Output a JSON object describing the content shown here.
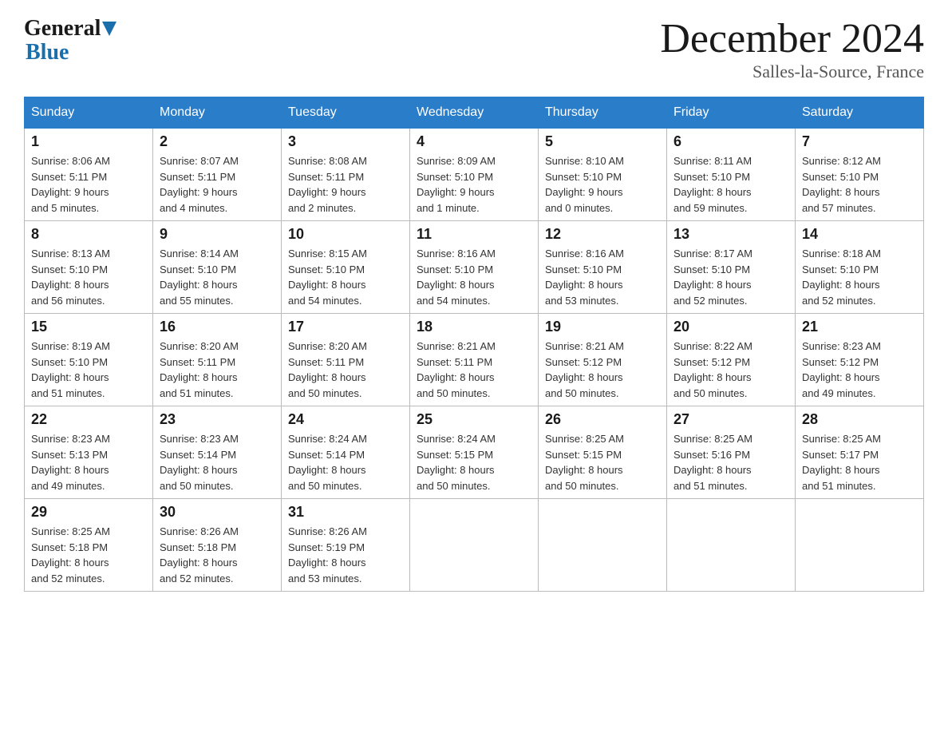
{
  "logo": {
    "general": "General",
    "blue": "Blue",
    "arrow": "▶"
  },
  "title": "December 2024",
  "location": "Salles-la-Source, France",
  "days_of_week": [
    "Sunday",
    "Monday",
    "Tuesday",
    "Wednesday",
    "Thursday",
    "Friday",
    "Saturday"
  ],
  "weeks": [
    [
      {
        "day": "1",
        "info": "Sunrise: 8:06 AM\nSunset: 5:11 PM\nDaylight: 9 hours\nand 5 minutes."
      },
      {
        "day": "2",
        "info": "Sunrise: 8:07 AM\nSunset: 5:11 PM\nDaylight: 9 hours\nand 4 minutes."
      },
      {
        "day": "3",
        "info": "Sunrise: 8:08 AM\nSunset: 5:11 PM\nDaylight: 9 hours\nand 2 minutes."
      },
      {
        "day": "4",
        "info": "Sunrise: 8:09 AM\nSunset: 5:10 PM\nDaylight: 9 hours\nand 1 minute."
      },
      {
        "day": "5",
        "info": "Sunrise: 8:10 AM\nSunset: 5:10 PM\nDaylight: 9 hours\nand 0 minutes."
      },
      {
        "day": "6",
        "info": "Sunrise: 8:11 AM\nSunset: 5:10 PM\nDaylight: 8 hours\nand 59 minutes."
      },
      {
        "day": "7",
        "info": "Sunrise: 8:12 AM\nSunset: 5:10 PM\nDaylight: 8 hours\nand 57 minutes."
      }
    ],
    [
      {
        "day": "8",
        "info": "Sunrise: 8:13 AM\nSunset: 5:10 PM\nDaylight: 8 hours\nand 56 minutes."
      },
      {
        "day": "9",
        "info": "Sunrise: 8:14 AM\nSunset: 5:10 PM\nDaylight: 8 hours\nand 55 minutes."
      },
      {
        "day": "10",
        "info": "Sunrise: 8:15 AM\nSunset: 5:10 PM\nDaylight: 8 hours\nand 54 minutes."
      },
      {
        "day": "11",
        "info": "Sunrise: 8:16 AM\nSunset: 5:10 PM\nDaylight: 8 hours\nand 54 minutes."
      },
      {
        "day": "12",
        "info": "Sunrise: 8:16 AM\nSunset: 5:10 PM\nDaylight: 8 hours\nand 53 minutes."
      },
      {
        "day": "13",
        "info": "Sunrise: 8:17 AM\nSunset: 5:10 PM\nDaylight: 8 hours\nand 52 minutes."
      },
      {
        "day": "14",
        "info": "Sunrise: 8:18 AM\nSunset: 5:10 PM\nDaylight: 8 hours\nand 52 minutes."
      }
    ],
    [
      {
        "day": "15",
        "info": "Sunrise: 8:19 AM\nSunset: 5:10 PM\nDaylight: 8 hours\nand 51 minutes."
      },
      {
        "day": "16",
        "info": "Sunrise: 8:20 AM\nSunset: 5:11 PM\nDaylight: 8 hours\nand 51 minutes."
      },
      {
        "day": "17",
        "info": "Sunrise: 8:20 AM\nSunset: 5:11 PM\nDaylight: 8 hours\nand 50 minutes."
      },
      {
        "day": "18",
        "info": "Sunrise: 8:21 AM\nSunset: 5:11 PM\nDaylight: 8 hours\nand 50 minutes."
      },
      {
        "day": "19",
        "info": "Sunrise: 8:21 AM\nSunset: 5:12 PM\nDaylight: 8 hours\nand 50 minutes."
      },
      {
        "day": "20",
        "info": "Sunrise: 8:22 AM\nSunset: 5:12 PM\nDaylight: 8 hours\nand 50 minutes."
      },
      {
        "day": "21",
        "info": "Sunrise: 8:23 AM\nSunset: 5:12 PM\nDaylight: 8 hours\nand 49 minutes."
      }
    ],
    [
      {
        "day": "22",
        "info": "Sunrise: 8:23 AM\nSunset: 5:13 PM\nDaylight: 8 hours\nand 49 minutes."
      },
      {
        "day": "23",
        "info": "Sunrise: 8:23 AM\nSunset: 5:14 PM\nDaylight: 8 hours\nand 50 minutes."
      },
      {
        "day": "24",
        "info": "Sunrise: 8:24 AM\nSunset: 5:14 PM\nDaylight: 8 hours\nand 50 minutes."
      },
      {
        "day": "25",
        "info": "Sunrise: 8:24 AM\nSunset: 5:15 PM\nDaylight: 8 hours\nand 50 minutes."
      },
      {
        "day": "26",
        "info": "Sunrise: 8:25 AM\nSunset: 5:15 PM\nDaylight: 8 hours\nand 50 minutes."
      },
      {
        "day": "27",
        "info": "Sunrise: 8:25 AM\nSunset: 5:16 PM\nDaylight: 8 hours\nand 51 minutes."
      },
      {
        "day": "28",
        "info": "Sunrise: 8:25 AM\nSunset: 5:17 PM\nDaylight: 8 hours\nand 51 minutes."
      }
    ],
    [
      {
        "day": "29",
        "info": "Sunrise: 8:25 AM\nSunset: 5:18 PM\nDaylight: 8 hours\nand 52 minutes."
      },
      {
        "day": "30",
        "info": "Sunrise: 8:26 AM\nSunset: 5:18 PM\nDaylight: 8 hours\nand 52 minutes."
      },
      {
        "day": "31",
        "info": "Sunrise: 8:26 AM\nSunset: 5:19 PM\nDaylight: 8 hours\nand 53 minutes."
      },
      {
        "day": "",
        "info": ""
      },
      {
        "day": "",
        "info": ""
      },
      {
        "day": "",
        "info": ""
      },
      {
        "day": "",
        "info": ""
      }
    ]
  ]
}
